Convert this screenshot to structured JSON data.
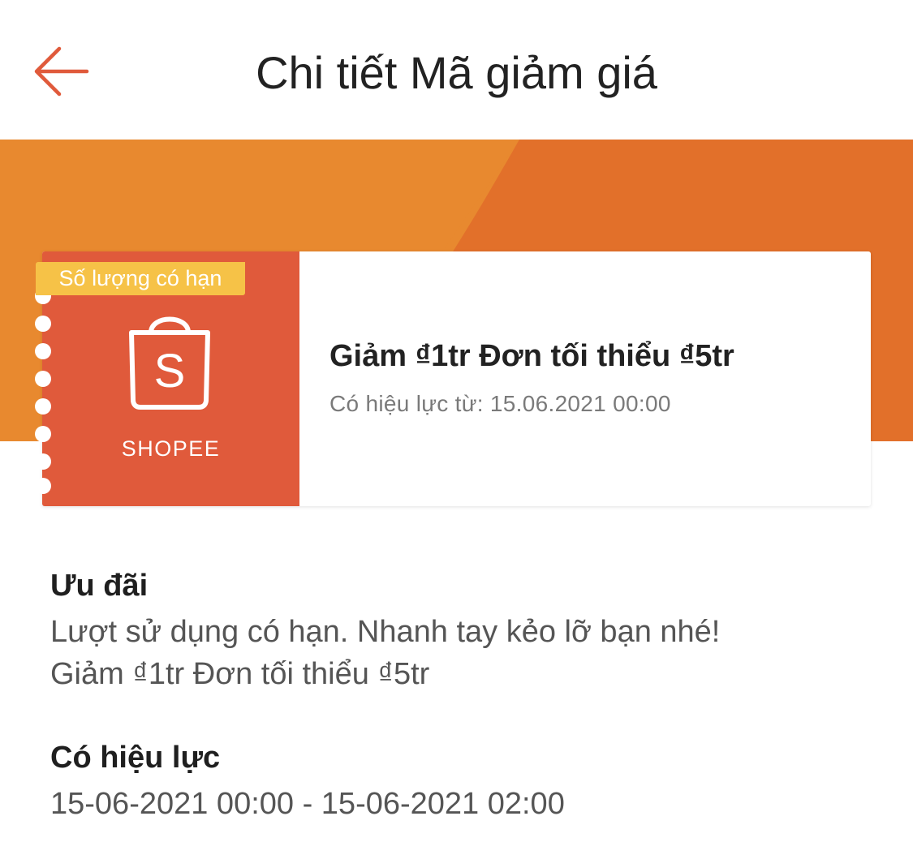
{
  "header": {
    "title": "Chi tiết Mã giảm giá",
    "back_icon": "arrow-left-icon",
    "accent_color": "#e05a3b"
  },
  "banner": {
    "color_light": "#e8892f",
    "color_dark": "#e2702a"
  },
  "voucher": {
    "badge": "Số lượng có hạn",
    "logo_icon": "shopping-bag-icon",
    "logo_letter": "S",
    "shop_name": "SHOPEE",
    "title": "Giảm ₫1tr Đơn tối thiểu ₫5tr",
    "validity": "Có hiệu lực từ: 15.06.2021 00:00",
    "left_color": "#e05a3b",
    "badge_color": "#f6c247"
  },
  "offer": {
    "heading": "Ưu đãi",
    "line1": "Lượt sử dụng có hạn. Nhanh tay kẻo lỡ bạn nhé!",
    "line2": "Giảm ₫1tr Đơn tối thiểu ₫5tr"
  },
  "validity": {
    "heading": "Có hiệu lực",
    "range": "15-06-2021 00:00 - 15-06-2021 02:00"
  }
}
